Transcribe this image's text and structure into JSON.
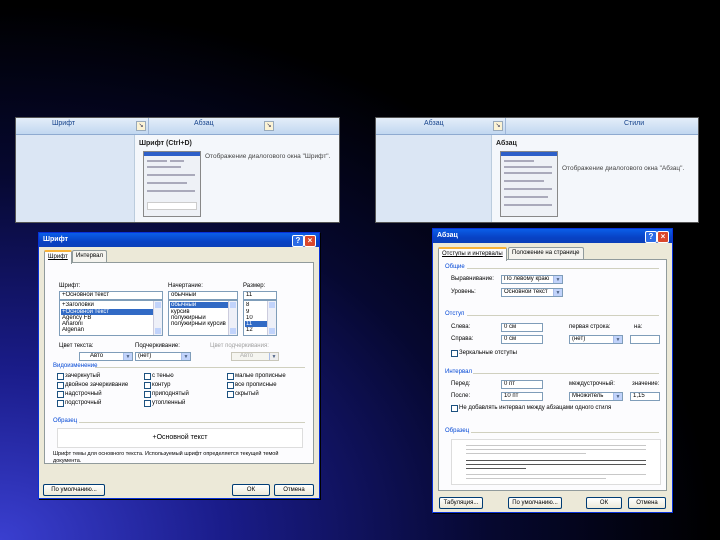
{
  "ribbon_font": {
    "group_label": "Шрифт",
    "next_group_label": "Абзац",
    "launcher_icon": "dialog-launcher-icon",
    "tooltip_title": "Шрифт (Ctrl+D)",
    "tooltip_desc": "Отображение диалогового окна \"Шрифт\"."
  },
  "ribbon_paragraph": {
    "group_label": "Абзац",
    "next_group_label": "Стили",
    "launcher_icon": "dialog-launcher-icon",
    "tooltip_title": "Абзац",
    "tooltip_desc": "Отображение диалогового окна \"Абзац\"."
  },
  "font_dialog": {
    "title": "Шрифт",
    "tabs": [
      "Шрифт",
      "Интервал"
    ],
    "font_label": "Шрифт:",
    "style_label": "Начертание:",
    "size_label": "Размер:",
    "font_value": "+Основной текст",
    "style_value": "обычный",
    "size_value": "11",
    "font_list": [
      "+Заголовки",
      "+Основной текст",
      "Agency FB",
      "Aharoni",
      "Algerian"
    ],
    "style_list": [
      "обычный",
      "курсив",
      "полужирный",
      "полужирный курсив"
    ],
    "size_list": [
      "8",
      "9",
      "10",
      "11",
      "12"
    ],
    "color_label": "Цвет текста:",
    "color_value": "Авто",
    "underline_label": "Подчеркивание:",
    "underline_value": "(нет)",
    "underline_color_label": "Цвет подчеркивания:",
    "underline_color_value": "Авто",
    "effects_label": "Видоизменение",
    "effects": [
      "зачеркнутый",
      "двойное зачеркивание",
      "надстрочный",
      "подстрочный",
      "с тенью",
      "контур",
      "приподнятый",
      "утопленный",
      "малые прописные",
      "все прописные",
      "скрытый"
    ],
    "sample_label": "Образец",
    "sample_text": "+Основной текст",
    "description": "Шрифт темы для основного текста. Используемый шрифт определяется текущей темой документа.",
    "default_button": "По умолчанию...",
    "ok_button": "ОК",
    "cancel_button": "Отмена",
    "accent_color": "#0a5ee8"
  },
  "para_dialog": {
    "title": "Абзац",
    "tabs": [
      "Отступы и интервалы",
      "Положение на странице"
    ],
    "general_label": "Общие",
    "alignment_label": "Выравнивание:",
    "alignment_value": "По левому краю",
    "level_label": "Уровень:",
    "level_value": "Основной текст",
    "indent_label": "Отступ",
    "left_label": "Слева:",
    "left_value": "0 см",
    "right_label": "Справа:",
    "right_value": "0 см",
    "first_line_label": "первая строка:",
    "first_line_value": "(нет)",
    "by_label": "на:",
    "mirror_label": "Зеркальные отступы",
    "spacing_label": "Интервал",
    "before_label": "Перед:",
    "before_value": "0 пт",
    "after_label": "После:",
    "after_value": "10 пт",
    "line_spacing_label": "междустрочный:",
    "line_spacing_value": "Множитель",
    "value_label": "значение:",
    "value_value": "1,15",
    "no_space_label": "Не добавлять интервал между абзацами одного стиля",
    "sample_label": "Образец",
    "tabs_button": "Табуляция...",
    "default_button": "По умолчанию...",
    "ok_button": "ОК",
    "cancel_button": "Отмена"
  }
}
